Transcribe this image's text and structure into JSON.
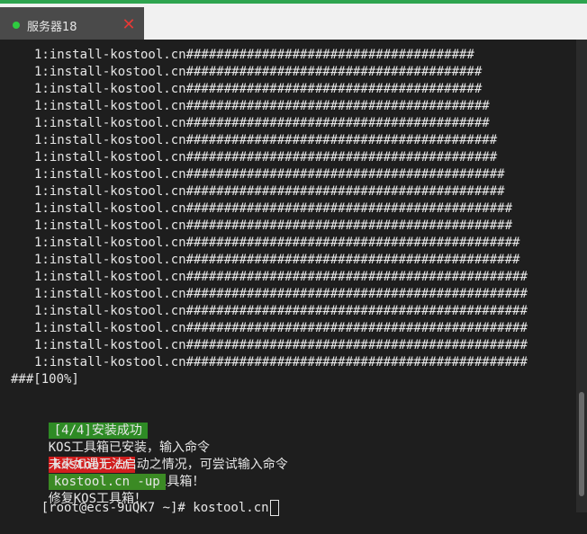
{
  "tab": {
    "title": "服务器18",
    "close_symbol": "✕",
    "status_color": "#2ecc40",
    "close_color": "#e53935"
  },
  "terminal": {
    "install_lines": [
      "1:install-kostool.cn######################################",
      "1:install-kostool.cn#######################################",
      "1:install-kostool.cn#######################################",
      "1:install-kostool.cn########################################",
      "1:install-kostool.cn########################################",
      "1:install-kostool.cn#########################################",
      "1:install-kostool.cn#########################################",
      "1:install-kostool.cn##########################################",
      "1:install-kostool.cn##########################################",
      "1:install-kostool.cn###########################################",
      "1:install-kostool.cn###########################################",
      "1:install-kostool.cn############################################",
      "1:install-kostool.cn############################################",
      "1:install-kostool.cn#############################################",
      "1:install-kostool.cn#############################################",
      "1:install-kostool.cn#############################################",
      "1:install-kostool.cn#############################################",
      "1:install-kostool.cn#############################################",
      "1:install-kostool.cn#############################################"
    ],
    "percent_line": "###[100%]",
    "success_badge": "[4/4]安装成功",
    "msg1_prefix": "KOS工具箱已安装，输入命令",
    "msg1_cmd": "kostool.cn",
    "msg1_suffix": "即可启动/更新KOS工具箱！",
    "msg2_prefix": "未来如遇无法启动之情况，可尝试输入命令",
    "msg2_cmd": "kostool.cn -up",
    "msg2_suffix": "修复KOS工具箱！",
    "prompt": "[root@ecs-9uQK7 ~]# kostool.cn"
  }
}
